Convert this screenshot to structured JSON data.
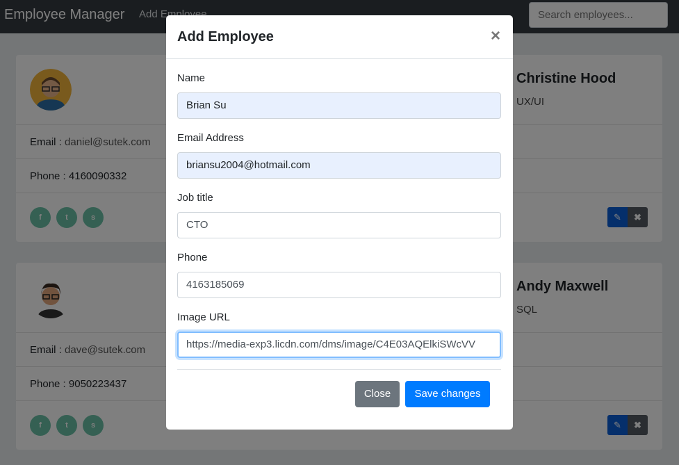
{
  "navbar": {
    "brand": "Employee Manager",
    "add_link": "Add Employee",
    "search_placeholder": "Search employees..."
  },
  "employees": [
    {
      "name": "",
      "email_label": "Email :",
      "email": "daniel@sutek.com",
      "phone_label": "Phone :",
      "phone": "4160090332"
    },
    {
      "name": "Christine Hood",
      "title": "UX/UI"
    },
    {
      "name": "",
      "email_label": "Email :",
      "email": "dave@sutek.com",
      "phone_label": "Phone :",
      "phone": "9050223437"
    },
    {
      "name": "Andy Maxwell",
      "title": "SQL"
    }
  ],
  "social_icons": [
    "f",
    "t",
    "s"
  ],
  "modal": {
    "title": "Add Employee",
    "close_symbol": "×",
    "fields": [
      {
        "label": "Name",
        "value": "Brian Su"
      },
      {
        "label": "Email Address",
        "value": "briansu2004@hotmail.com"
      },
      {
        "label": "Job title",
        "value": "CTO"
      },
      {
        "label": "Phone",
        "value": "4163185069"
      },
      {
        "label": "Image URL",
        "value": "https://media-exp3.licdn.com/dms/image/C4E03AQElkiSWcVV"
      }
    ],
    "close_button": "Close",
    "save_button": "Save changes"
  },
  "colors": {
    "navbar": "#343a40",
    "primary": "#007bff",
    "secondary": "#6c757d",
    "social": "#6bc0a6",
    "autofill": "#e8f0fe"
  }
}
